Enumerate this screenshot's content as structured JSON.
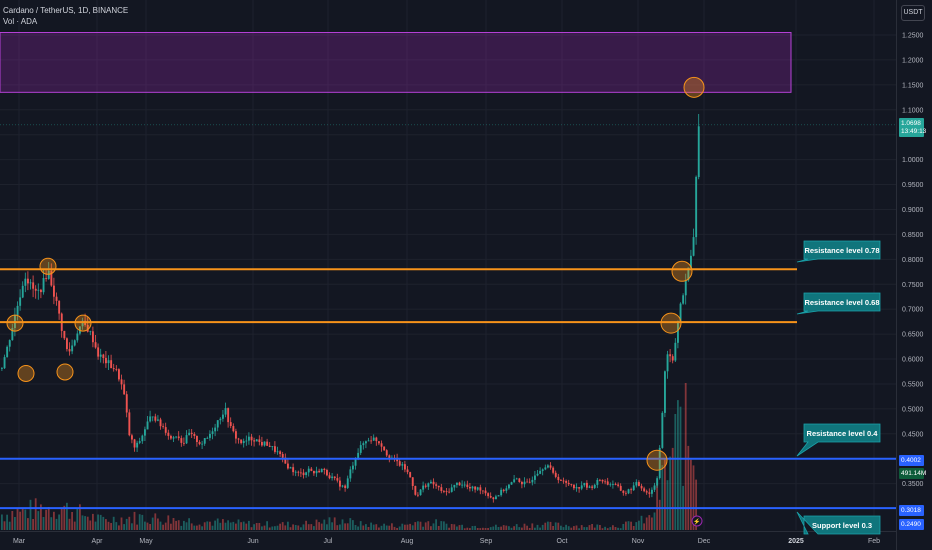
{
  "header": {
    "symbol_line": "Cardano / TetherUS, 1D, BINANCE",
    "volume_line": "Vol · ADA"
  },
  "price_axis": {
    "currency_button": "USDT",
    "current_price": "1.0698",
    "countdown": "13:49:13",
    "tag_0_4": "0.4002",
    "tag_volume": "491.14M",
    "tag_0_3": "0.3018",
    "tag_low": "0.2490"
  },
  "colors": {
    "background": "#131722",
    "up": "#26a69a",
    "down": "#ef5350",
    "resistance_line": "#f7931a",
    "support_line": "#2962ff",
    "target_zone": "#9c27b0",
    "callout": "#10757c"
  },
  "chart_data": {
    "type": "candlestick",
    "x_ticks": [
      "Mar",
      "Apr",
      "May",
      "Jun",
      "Jul",
      "Aug",
      "Sep",
      "Oct",
      "Nov",
      "Dec",
      "2025",
      "Feb"
    ],
    "y_ticks": [
      "1.2500",
      "1.2000",
      "1.1500",
      "1.1000",
      "1.0500",
      "1.0000",
      "0.9500",
      "0.9000",
      "0.8500",
      "0.8000",
      "0.7500",
      "0.7000",
      "0.6500",
      "0.6000",
      "0.5500",
      "0.5000",
      "0.4500",
      "0.4000",
      "0.3500"
    ],
    "ylim": [
      0.245,
      1.27
    ],
    "grid": true,
    "levels": [
      {
        "label": "Resistance level 0.78",
        "value": 0.78,
        "color": "#f7931a"
      },
      {
        "label": "Resistance level 0.68",
        "value": 0.674,
        "color": "#f7931a"
      },
      {
        "label": "Resistance level 0.4",
        "value": 0.4,
        "color": "#2962ff"
      },
      {
        "label": "Support level 0.3",
        "value": 0.301,
        "color": "#2962ff"
      }
    ],
    "target_zone": {
      "from": 1.135,
      "to": 1.255
    },
    "path": [
      [
        0,
        0.58
      ],
      [
        6,
        0.62
      ],
      [
        12,
        0.67
      ],
      [
        18,
        0.72
      ],
      [
        24,
        0.77
      ],
      [
        30,
        0.745
      ],
      [
        36,
        0.73
      ],
      [
        42,
        0.75
      ],
      [
        47,
        0.78
      ],
      [
        52,
        0.74
      ],
      [
        57,
        0.7
      ],
      [
        62,
        0.65
      ],
      [
        67,
        0.61
      ],
      [
        72,
        0.63
      ],
      [
        77,
        0.66
      ],
      [
        82,
        0.67
      ],
      [
        87,
        0.66
      ],
      [
        92,
        0.64
      ],
      [
        97,
        0.61
      ],
      [
        102,
        0.6
      ],
      [
        108,
        0.59
      ],
      [
        114,
        0.58
      ],
      [
        119,
        0.56
      ],
      [
        124,
        0.52
      ],
      [
        128,
        0.45
      ],
      [
        134,
        0.42
      ],
      [
        140,
        0.44
      ],
      [
        146,
        0.47
      ],
      [
        152,
        0.49
      ],
      [
        158,
        0.47
      ],
      [
        164,
        0.46
      ],
      [
        170,
        0.44
      ],
      [
        176,
        0.45
      ],
      [
        182,
        0.43
      ],
      [
        188,
        0.45
      ],
      [
        194,
        0.44
      ],
      [
        200,
        0.43
      ],
      [
        206,
        0.44
      ],
      [
        212,
        0.46
      ],
      [
        218,
        0.48
      ],
      [
        224,
        0.5
      ],
      [
        230,
        0.46
      ],
      [
        236,
        0.44
      ],
      [
        242,
        0.43
      ],
      [
        248,
        0.44
      ],
      [
        254,
        0.44
      ],
      [
        260,
        0.43
      ],
      [
        266,
        0.43
      ],
      [
        272,
        0.42
      ],
      [
        278,
        0.41
      ],
      [
        284,
        0.39
      ],
      [
        290,
        0.38
      ],
      [
        296,
        0.37
      ],
      [
        302,
        0.37
      ],
      [
        308,
        0.38
      ],
      [
        314,
        0.37
      ],
      [
        320,
        0.38
      ],
      [
        326,
        0.37
      ],
      [
        332,
        0.36
      ],
      [
        338,
        0.35
      ],
      [
        344,
        0.34
      ],
      [
        350,
        0.38
      ],
      [
        356,
        0.41
      ],
      [
        362,
        0.43
      ],
      [
        368,
        0.44
      ],
      [
        374,
        0.44
      ],
      [
        380,
        0.43
      ],
      [
        386,
        0.41
      ],
      [
        392,
        0.4
      ],
      [
        398,
        0.39
      ],
      [
        404,
        0.38
      ],
      [
        410,
        0.36
      ],
      [
        416,
        0.32
      ],
      [
        420,
        0.34
      ],
      [
        426,
        0.35
      ],
      [
        432,
        0.35
      ],
      [
        438,
        0.34
      ],
      [
        444,
        0.33
      ],
      [
        450,
        0.34
      ],
      [
        456,
        0.35
      ],
      [
        462,
        0.35
      ],
      [
        468,
        0.34
      ],
      [
        474,
        0.34
      ],
      [
        480,
        0.34
      ],
      [
        486,
        0.33
      ],
      [
        492,
        0.32
      ],
      [
        498,
        0.33
      ],
      [
        504,
        0.34
      ],
      [
        510,
        0.35
      ],
      [
        516,
        0.36
      ],
      [
        522,
        0.35
      ],
      [
        528,
        0.35
      ],
      [
        534,
        0.37
      ],
      [
        540,
        0.38
      ],
      [
        546,
        0.39
      ],
      [
        552,
        0.37
      ],
      [
        558,
        0.36
      ],
      [
        564,
        0.35
      ],
      [
        570,
        0.35
      ],
      [
        576,
        0.34
      ],
      [
        582,
        0.35
      ],
      [
        588,
        0.34
      ],
      [
        594,
        0.35
      ],
      [
        600,
        0.36
      ],
      [
        606,
        0.35
      ],
      [
        612,
        0.35
      ],
      [
        618,
        0.34
      ],
      [
        624,
        0.33
      ],
      [
        630,
        0.34
      ],
      [
        636,
        0.35
      ],
      [
        642,
        0.34
      ],
      [
        648,
        0.33
      ],
      [
        652,
        0.34
      ],
      [
        656,
        0.36
      ],
      [
        660,
        0.45
      ],
      [
        664,
        0.57
      ],
      [
        668,
        0.62
      ],
      [
        672,
        0.59
      ],
      [
        676,
        0.66
      ],
      [
        680,
        0.72
      ],
      [
        684,
        0.74
      ],
      [
        688,
        0.79
      ],
      [
        692,
        0.82
      ],
      [
        694,
        0.9
      ],
      [
        696,
        1.0
      ],
      [
        697,
        1.04
      ],
      [
        698,
        1.07
      ]
    ]
  },
  "volume_data": {
    "ylim": [
      0,
      1200
    ],
    "path": [
      [
        0,
        110
      ],
      [
        40,
        150
      ],
      [
        60,
        160
      ],
      [
        100,
        70
      ],
      [
        140,
        90
      ],
      [
        200,
        60
      ],
      [
        260,
        40
      ],
      [
        300,
        40
      ],
      [
        340,
        70
      ],
      [
        360,
        40
      ],
      [
        400,
        30
      ],
      [
        420,
        60
      ],
      [
        460,
        30
      ],
      [
        500,
        25
      ],
      [
        540,
        40
      ],
      [
        580,
        30
      ],
      [
        620,
        30
      ],
      [
        650,
        80
      ],
      [
        660,
        300
      ],
      [
        670,
        500
      ],
      [
        680,
        720
      ],
      [
        690,
        580
      ],
      [
        698,
        480
      ]
    ]
  },
  "annotations": {
    "circles": [
      {
        "x": 15,
        "value": 0.672
      },
      {
        "x": 48,
        "value": 0.786
      },
      {
        "x": 83,
        "value": 0.672
      },
      {
        "x": 26,
        "value": 0.571
      },
      {
        "x": 65,
        "value": 0.574
      },
      {
        "x": 682,
        "value": 0.776
      },
      {
        "x": 671,
        "value": 0.672
      },
      {
        "x": 657,
        "value": 0.397
      },
      {
        "x": 694,
        "value": 1.145
      }
    ]
  }
}
